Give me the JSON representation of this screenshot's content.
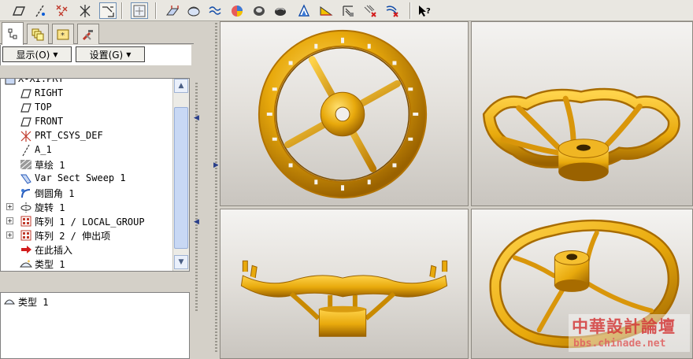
{
  "toolbar": {
    "tools": [
      {
        "name": "datum-plane-tool-icon"
      },
      {
        "name": "datum-axis-tool-icon"
      },
      {
        "name": "datum-point-tool-icon"
      },
      {
        "name": "coordinate-system-tool-icon"
      },
      {
        "name": "analysis-feature-icon"
      },
      {
        "name": "sketch-tool-icon"
      },
      {
        "name": "extrude-feature-icon"
      },
      {
        "name": "revolve-feature-icon"
      },
      {
        "name": "sweep-feature-icon"
      },
      {
        "name": "blend-feature-icon"
      },
      {
        "name": "shell-feature-icon"
      },
      {
        "name": "draft-feature-icon"
      },
      {
        "name": "round-feature-icon"
      },
      {
        "name": "rib-feature-icon"
      },
      {
        "name": "hole-feature-icon"
      },
      {
        "name": "pattern-feature-icon"
      },
      {
        "name": "merge-feature-icon"
      },
      {
        "name": "context-help-icon"
      }
    ]
  },
  "left_panel": {
    "tabs": [
      {
        "name": "model-tree-tab",
        "active": true
      },
      {
        "name": "layers-tab",
        "active": false
      },
      {
        "name": "favorites-tab",
        "active": false
      },
      {
        "name": "tools-tab",
        "active": false
      }
    ],
    "menu": {
      "show_label": "显示(O)",
      "settings_label": "设置(G)"
    },
    "tree": {
      "root_label": "X-XI.PRT",
      "items": [
        {
          "label": "RIGHT",
          "icon": "datum-plane-icon",
          "expander": ""
        },
        {
          "label": "TOP",
          "icon": "datum-plane-icon",
          "expander": ""
        },
        {
          "label": "FRONT",
          "icon": "datum-plane-icon",
          "expander": ""
        },
        {
          "label": "PRT_CSYS_DEF",
          "icon": "coordinate-system-icon",
          "expander": ""
        },
        {
          "label": "A_1",
          "icon": "datum-axis-icon",
          "expander": ""
        },
        {
          "label": "草绘 1",
          "icon": "sketch-icon",
          "expander": ""
        },
        {
          "label": "Var Sect Sweep 1",
          "icon": "sweep-icon",
          "expander": ""
        },
        {
          "label": "倒圆角 1",
          "icon": "round-icon",
          "expander": ""
        },
        {
          "label": "旋转 1",
          "icon": "revolve-icon",
          "expander": "+"
        },
        {
          "label": "阵列 1 / LOCAL_GROUP",
          "icon": "pattern-icon",
          "expander": "+"
        },
        {
          "label": "阵列 2 / 伸出项",
          "icon": "pattern-icon",
          "expander": "+"
        },
        {
          "label": "在此插入",
          "icon": "insert-here-arrow-icon",
          "expander": ""
        },
        {
          "label": "类型 1",
          "icon": "type-feature-icon",
          "expander": ""
        }
      ]
    },
    "lower_item_label": "类型 1"
  },
  "colors": {
    "part": "#e8a90c",
    "part_dark": "#a86c00",
    "part_light": "#ffd75a"
  },
  "watermark": {
    "title": "中華設計論壇",
    "url": "bbs.chinade.net"
  }
}
